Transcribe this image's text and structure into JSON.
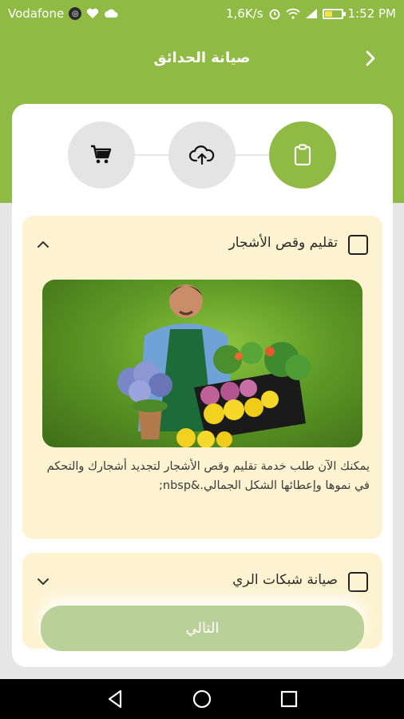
{
  "status_bar": {
    "carrier": "Vodafone",
    "speed": "1,6K/s",
    "time": "1:52 PM"
  },
  "header": {
    "title": "صيانة الحدائق"
  },
  "steps": [
    {
      "icon": "clipboard-icon",
      "active": true
    },
    {
      "icon": "cloud-upload-icon",
      "active": false
    },
    {
      "icon": "cart-icon",
      "active": false
    }
  ],
  "services": [
    {
      "title": "تقليم وقص الأشجار",
      "checked": false,
      "expanded": true,
      "description": "يمكنك الآن طلب خدمة تقليم وقص الأشجار لتجديد أشجارك والتحكم في نموها وإعطائها الشكل الجمالي.&nbsp;"
    },
    {
      "title": "صيانة شبكات الري",
      "checked": false,
      "expanded": false
    }
  ],
  "actions": {
    "next_label": "التالي"
  },
  "colors": {
    "brand": "#8fbb45",
    "accordion_bg": "#fdf3d0",
    "button_disabled": "#b9d099"
  }
}
